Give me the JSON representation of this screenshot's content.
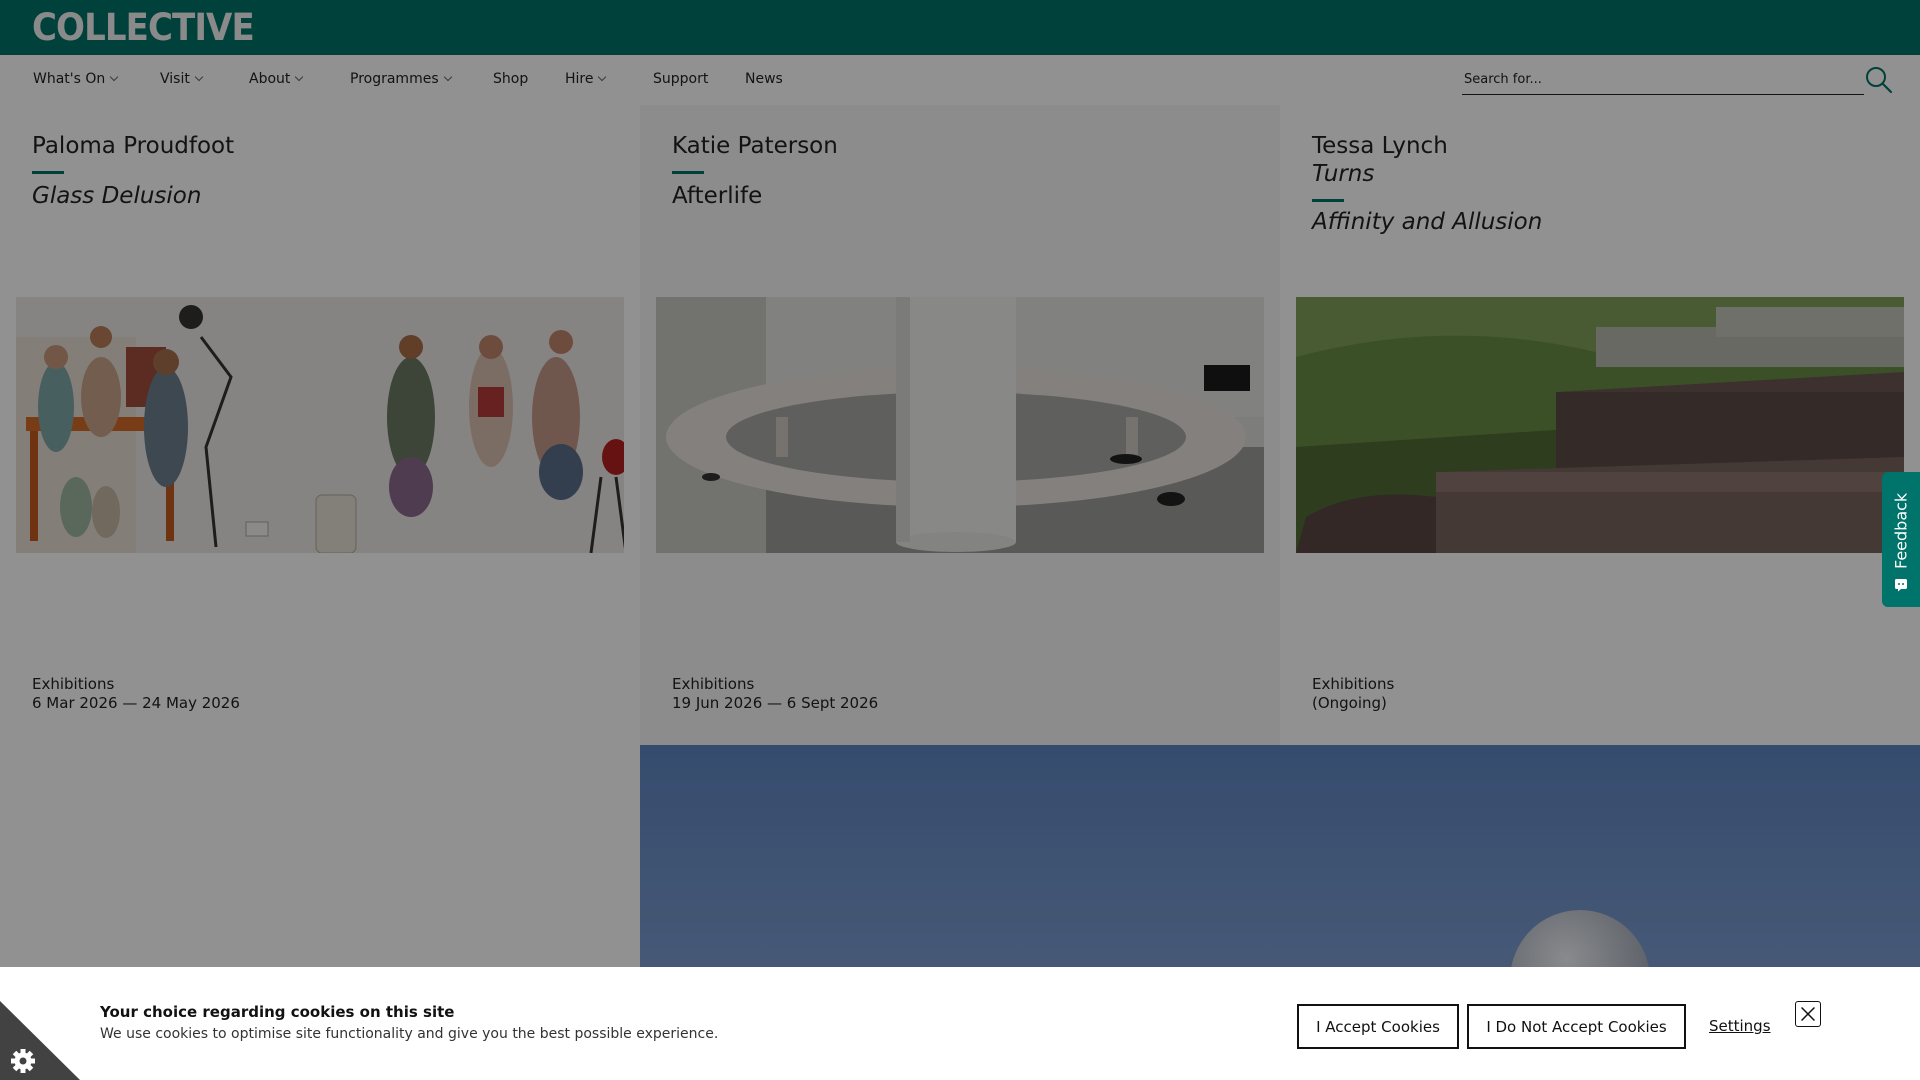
{
  "header": {
    "logo_text": "COLLECTIVE",
    "brand_color": "#00736a"
  },
  "nav": {
    "items": [
      {
        "label": "What's On",
        "has_dropdown": true
      },
      {
        "label": "Visit",
        "has_dropdown": true
      },
      {
        "label": "About",
        "has_dropdown": true
      },
      {
        "label": "Programmes",
        "has_dropdown": true
      },
      {
        "label": "Shop",
        "has_dropdown": false
      },
      {
        "label": "Hire",
        "has_dropdown": true
      },
      {
        "label": "Support",
        "has_dropdown": false
      },
      {
        "label": "News",
        "has_dropdown": false
      }
    ],
    "search": {
      "placeholder": "Search for...",
      "value": "",
      "icon": "search-icon"
    }
  },
  "cards": [
    {
      "artist": "Paloma Proudfoot",
      "title": "Glass Delusion",
      "category": "Exhibitions",
      "dates": "6 Mar 2026 — 24 May 2026"
    },
    {
      "artist": "Katie Paterson",
      "title": "Afterlife",
      "category": "Exhibitions",
      "dates": "19 Jun 2026 — 6 Sept 2026"
    },
    {
      "artist": "Tessa Lynch",
      "subtitle": "Turns",
      "title": "Affinity and Allusion",
      "category": "Exhibitions",
      "dates": "(Ongoing)"
    }
  ],
  "feedback_tab": {
    "label": "Feedback"
  },
  "cookie_banner": {
    "title": "Your choice regarding cookies on this site",
    "text": "We use cookies to optimise site functionality and give you the best possible experience.",
    "accept_label": "I Accept Cookies",
    "decline_label": "I Do Not Accept Cookies",
    "settings_label": "Settings",
    "corner_icon": "gear-icon",
    "close_icon": "close-icon"
  }
}
